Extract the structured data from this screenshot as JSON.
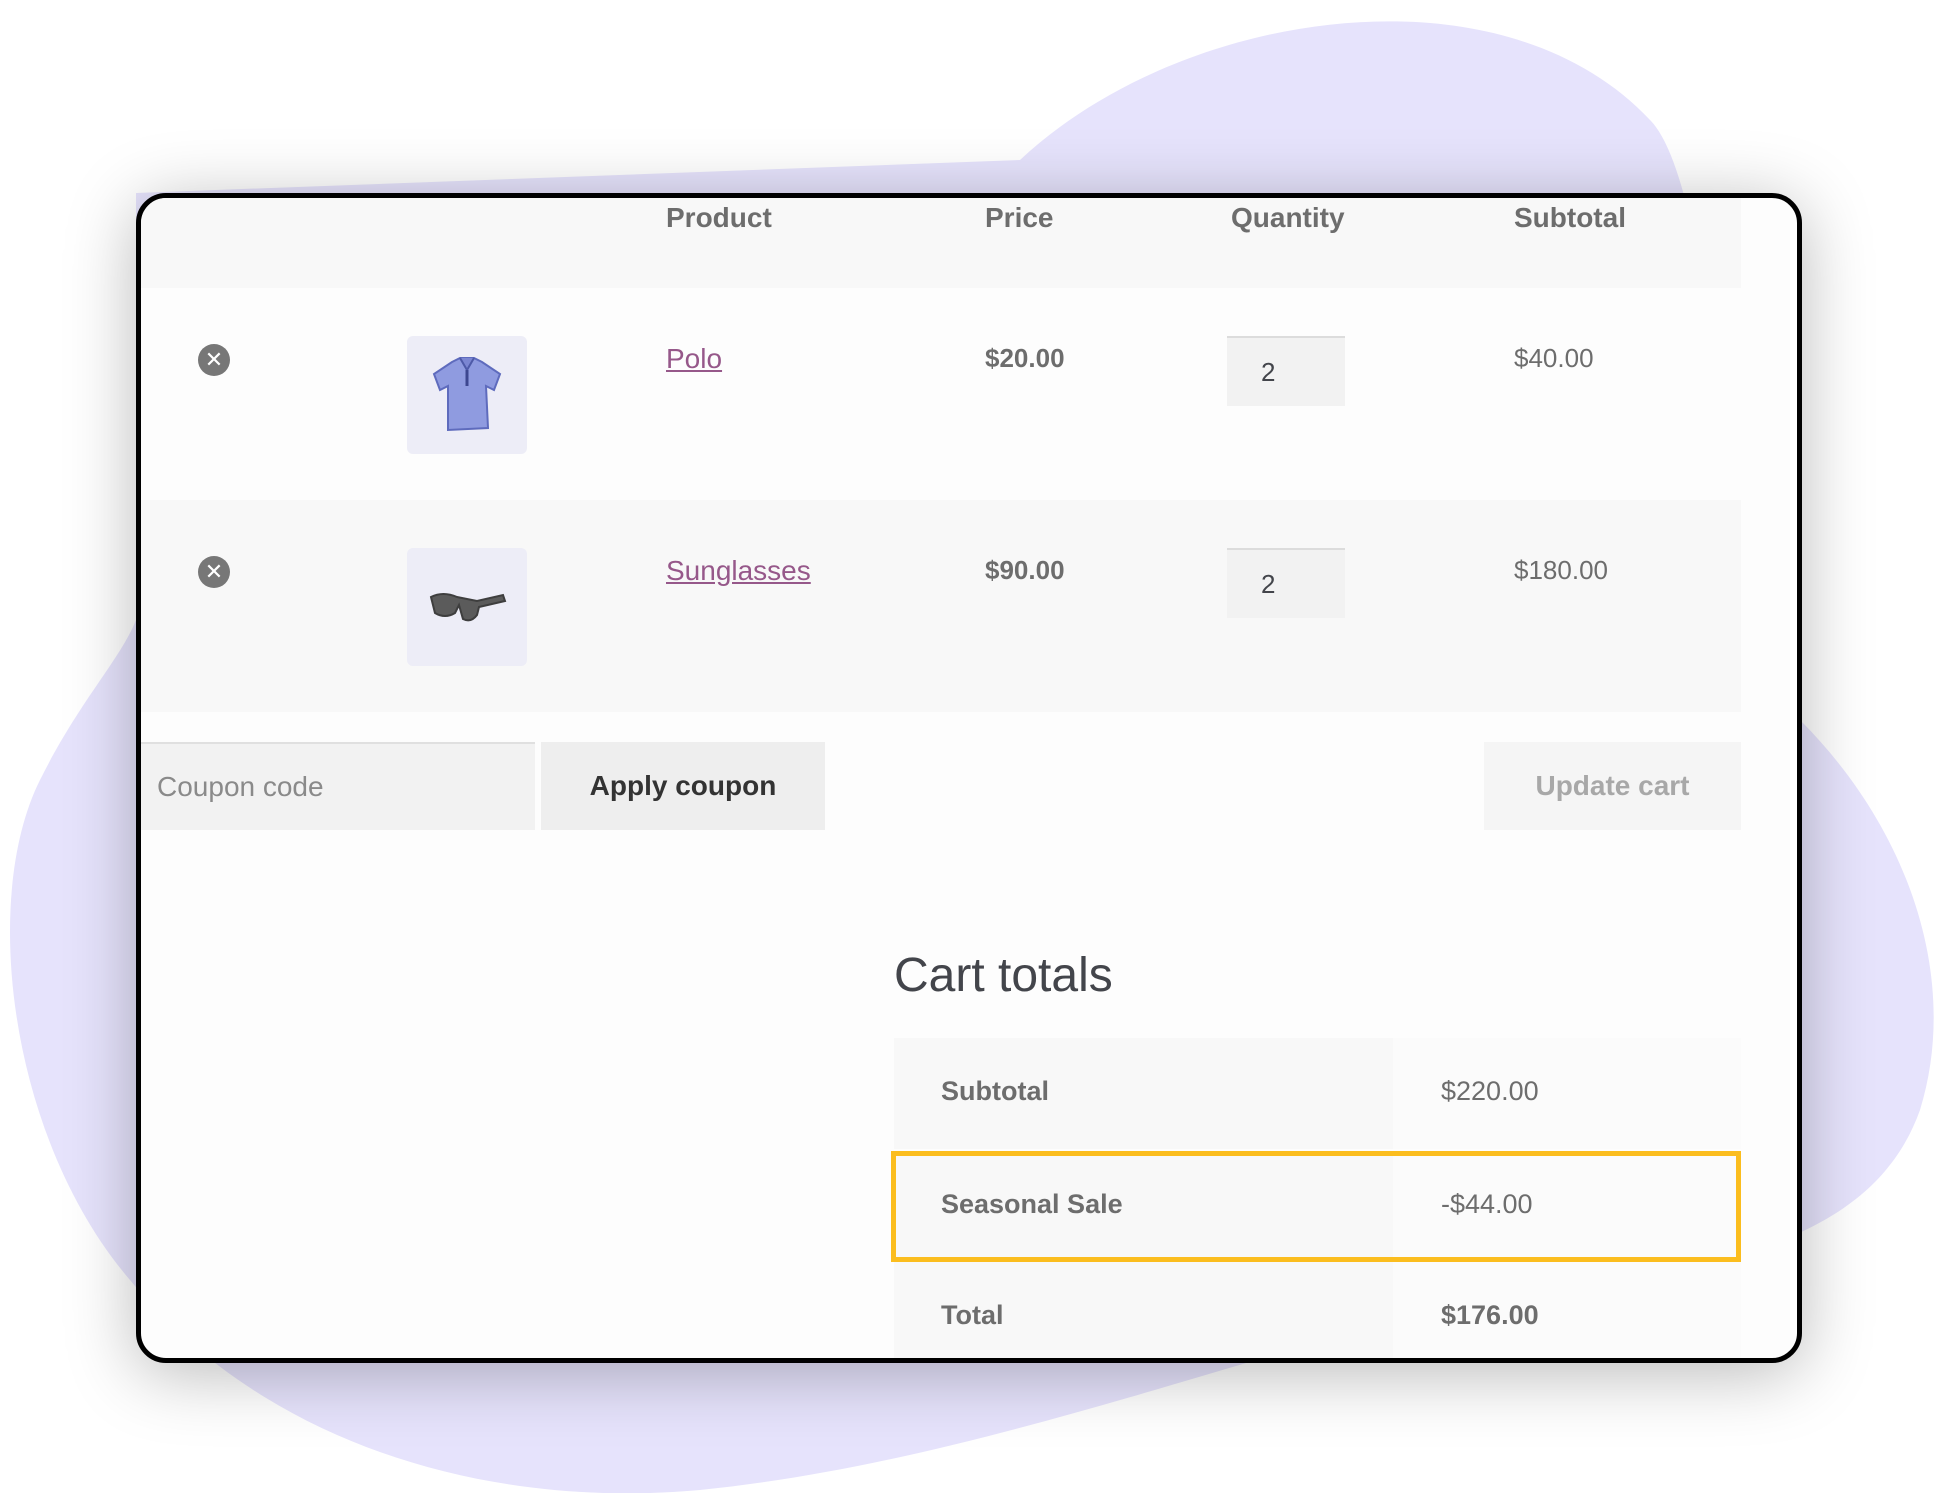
{
  "cart_table": {
    "headers": {
      "product": "Product",
      "price": "Price",
      "quantity": "Quantity",
      "subtotal": "Subtotal"
    },
    "rows": [
      {
        "product_name": "Polo",
        "thumbnail_icon": "polo-shirt-icon",
        "price": "$20.00",
        "quantity": "2",
        "subtotal": "$40.00",
        "remove_icon": "remove-circle-x-icon"
      },
      {
        "product_name": "Sunglasses",
        "thumbnail_icon": "sunglasses-icon",
        "price": "$90.00",
        "quantity": "2",
        "subtotal": "$180.00",
        "remove_icon": "remove-circle-x-icon"
      }
    ],
    "remove_glyph": "✕"
  },
  "coupon": {
    "placeholder": "Coupon code",
    "value": "",
    "apply_label": "Apply coupon"
  },
  "update_cart_label": "Update cart",
  "cart_totals": {
    "title": "Cart totals",
    "rows": [
      {
        "label": "Subtotal",
        "value": "$220.00"
      },
      {
        "label": "Seasonal Sale",
        "value": "-$44.00",
        "highlighted": true
      },
      {
        "label": "Total",
        "value": "$176.00"
      }
    ]
  },
  "colors": {
    "link": "#96588a",
    "highlight": "#fbbd1e",
    "background_blob": "#e6e3fc",
    "frame_border": "#000000"
  }
}
